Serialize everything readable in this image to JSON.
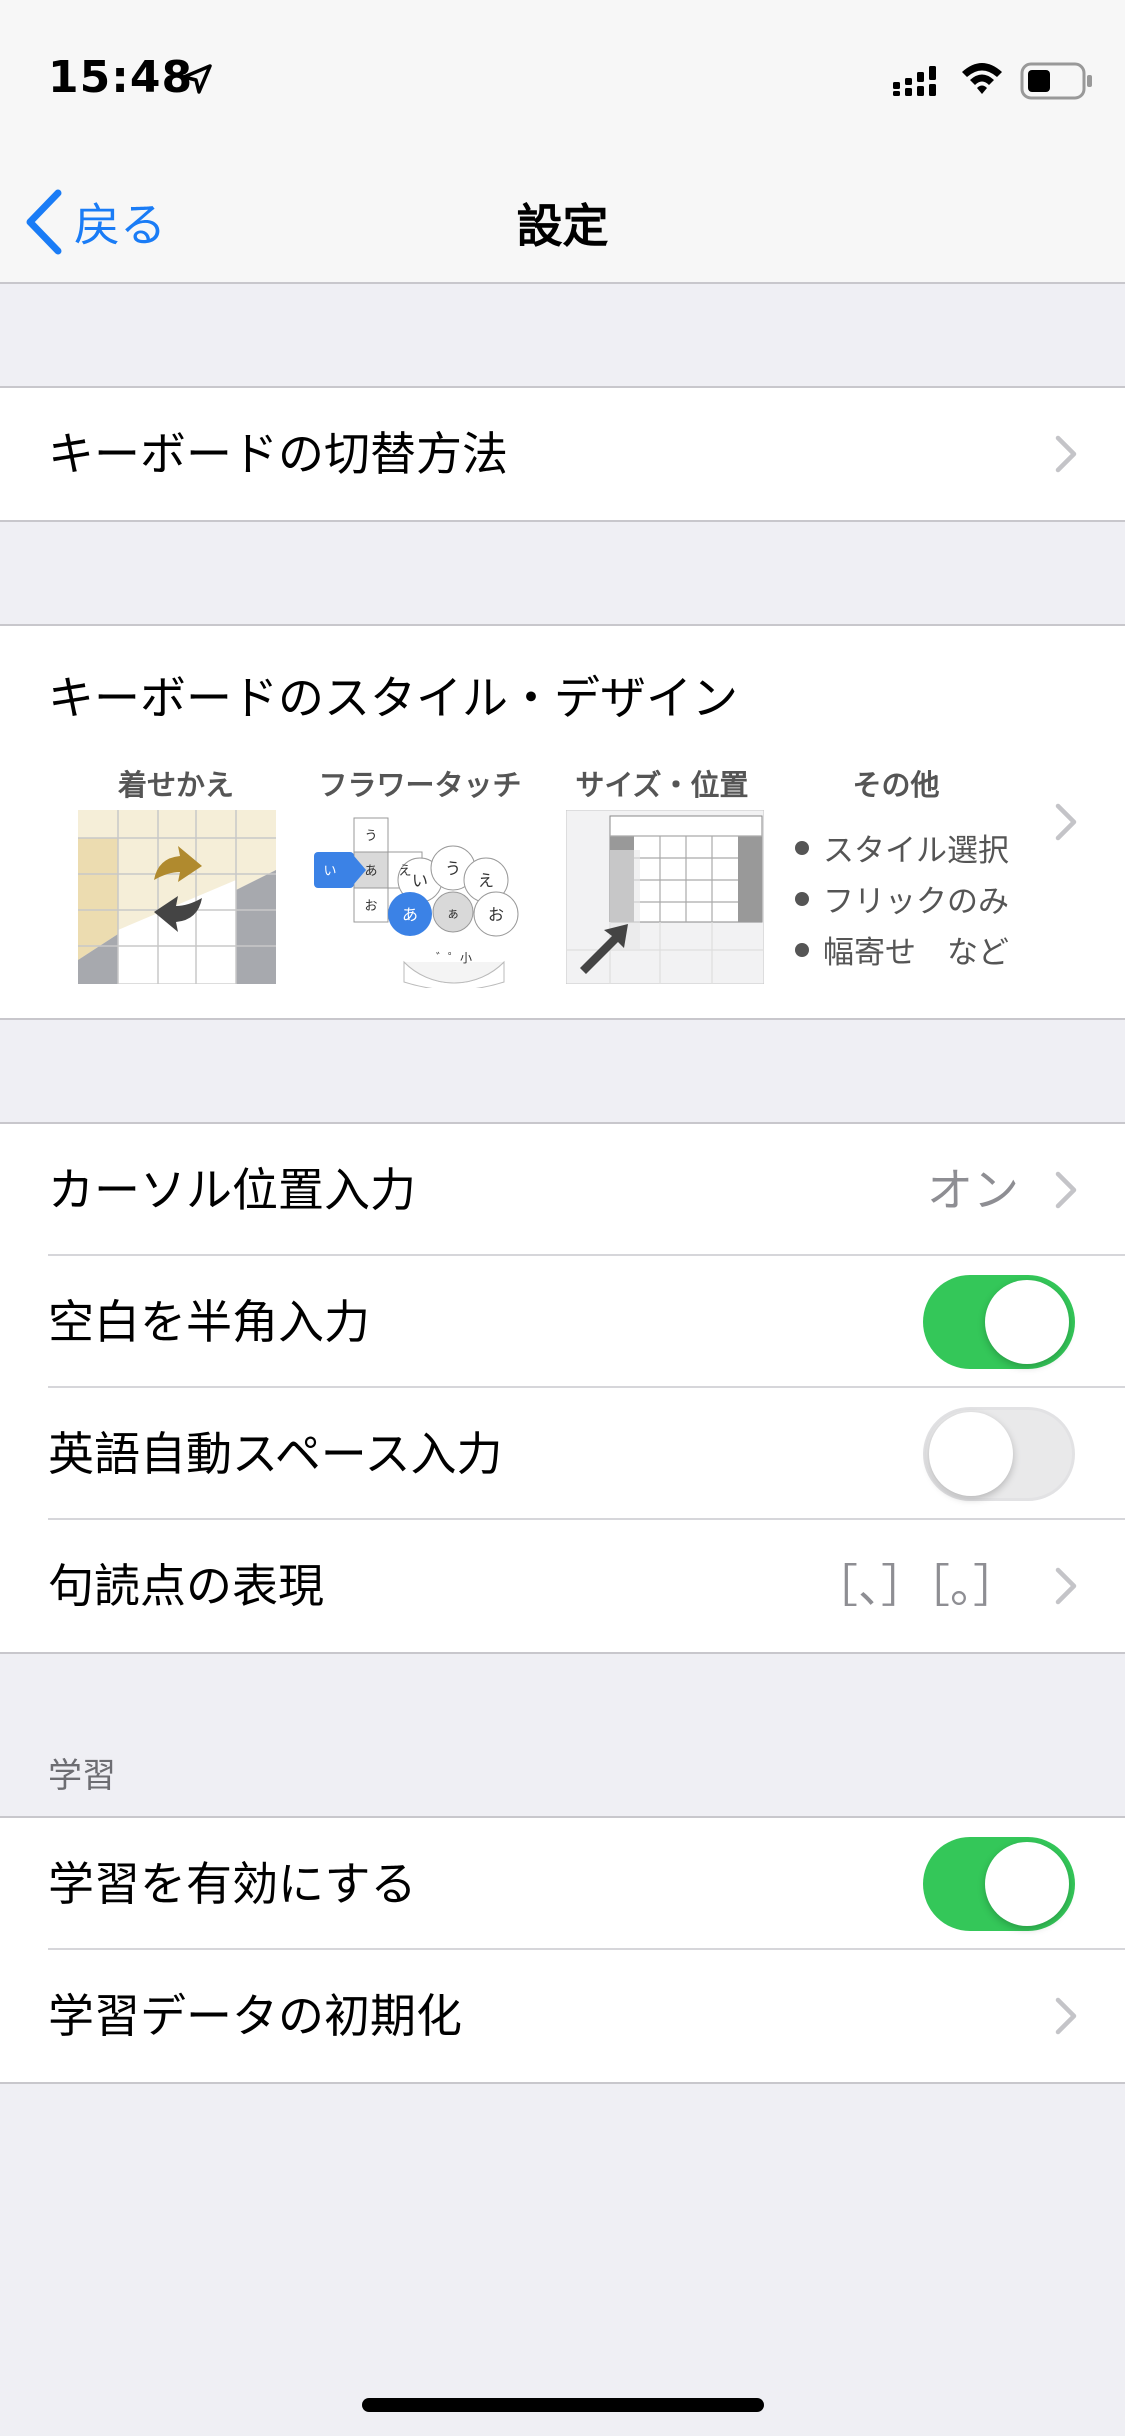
{
  "status_bar": {
    "time": "15:48"
  },
  "nav": {
    "back_label": "戻る",
    "title": "設定"
  },
  "rows": {
    "keyboard_switch": "キーボードの切替方法",
    "style_design": "キーボードのスタイル・デザイン",
    "cursor_input": {
      "label": "カーソル位置入力",
      "value": "オン"
    },
    "halfwidth_space": {
      "label": "空白を半角入力",
      "toggle": "on"
    },
    "english_auto_space": {
      "label": "英語自動スペース入力",
      "toggle": "off"
    },
    "punctuation": {
      "label": "句読点の表現",
      "value": "［、］［。］"
    }
  },
  "style_preview": {
    "labels": [
      "着せかえ",
      "フラワータッチ",
      "サイズ・位置",
      "その他"
    ],
    "others": [
      "スタイル選択",
      "フリックのみ",
      "幅寄せ　など"
    ],
    "flower_keys": [
      "う",
      "い",
      "あ",
      "え",
      "お",
      "う",
      "い",
      "え",
      "あ",
      "ぁ",
      "お",
      "゛゜小"
    ]
  },
  "learning": {
    "section_header": "学習",
    "enable": {
      "label": "学習を有効にする",
      "toggle": "on"
    },
    "reset": {
      "label": "学習データの初期化"
    }
  },
  "colors": {
    "accent": "#1a7cf6",
    "toggle_on": "#34c759",
    "background": "#efeff4"
  }
}
